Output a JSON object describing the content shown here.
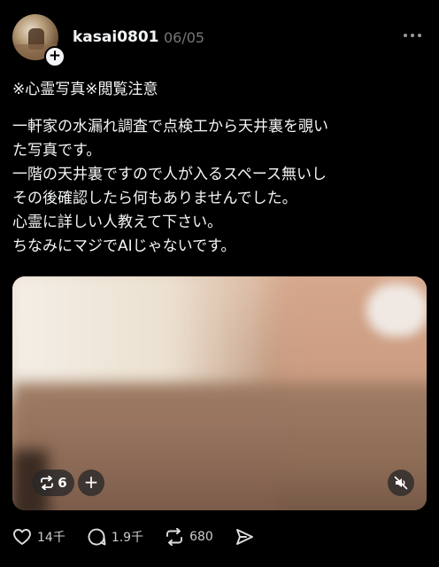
{
  "post": {
    "username": "kasai0801",
    "date": "06/05",
    "title": "※心霊写真※閲覧注意",
    "body_lines": [
      "一軒家の水漏れ調査で点検工から天井裏を覗い",
      "た写真です。",
      "一階の天井裏ですので人が入るスペース無いし",
      "その後確認したら何もありませんでした。",
      "心霊に詳しい人教えて下さい。",
      "ちなみにマジでAIじゃないです。"
    ]
  },
  "media": {
    "repost_count": "6",
    "plus_label": "+"
  },
  "actions": {
    "likes": "14千",
    "replies": "1.9千",
    "reposts": "680"
  },
  "icons": {
    "more": "more-dots-icon",
    "like": "heart-icon",
    "reply": "reply-bubble-icon",
    "repost": "repost-icon",
    "share": "send-icon",
    "mute": "speaker-muted-icon"
  },
  "colors": {
    "background": "#000000",
    "text": "#f3f5f7",
    "muted": "#777777"
  }
}
